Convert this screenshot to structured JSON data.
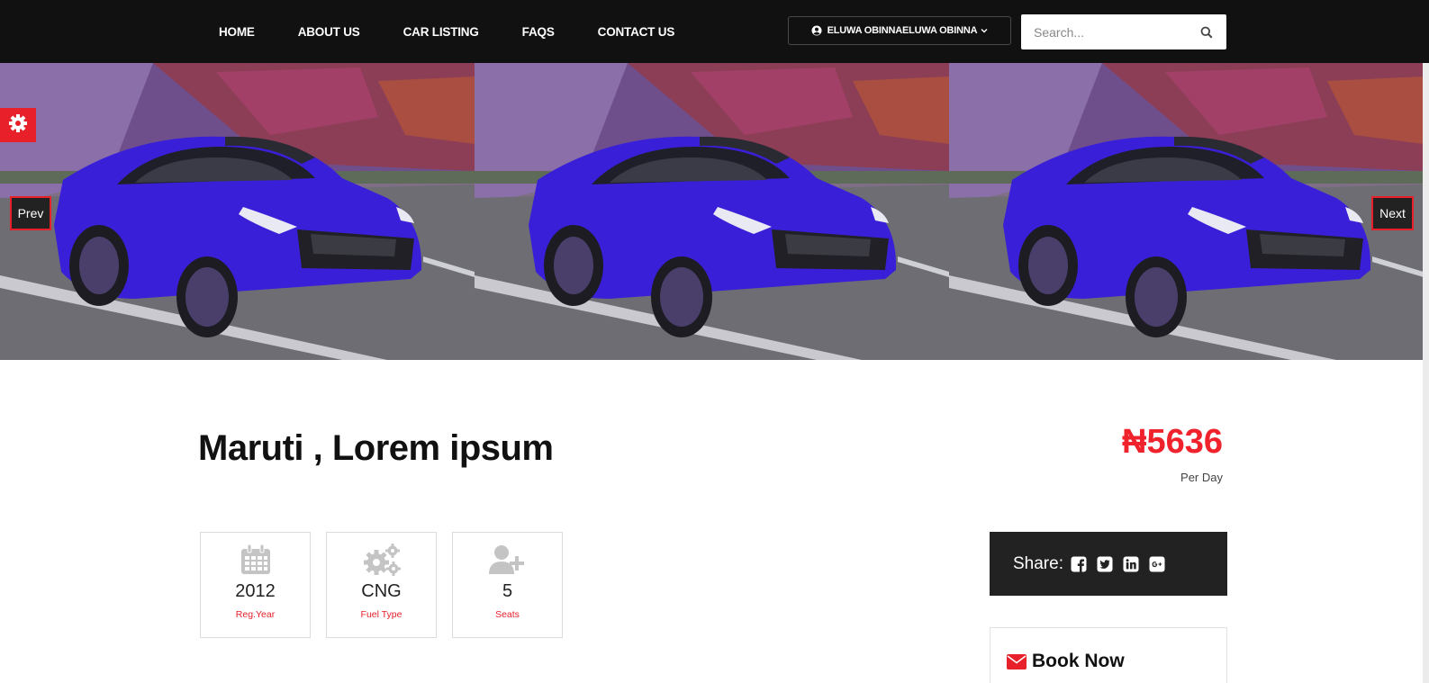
{
  "nav": {
    "items": [
      "HOME",
      "ABOUT US",
      "CAR LISTING",
      "FAQS",
      "CONTACT US"
    ]
  },
  "user_menu": {
    "label": "ELUWA OBINNAELUWA OBINNA"
  },
  "search": {
    "placeholder": "Search..."
  },
  "carousel": {
    "prev_label": "Prev",
    "next_label": "Next",
    "slide_count": 3
  },
  "vehicle": {
    "title": "Maruti , Lorem ipsum",
    "price": "₦5636",
    "price_period": "Per Day"
  },
  "specs": [
    {
      "icon": "calendar-icon",
      "value": "2012",
      "label": "Reg.Year"
    },
    {
      "icon": "gears-icon",
      "value": "CNG",
      "label": "Fuel Type"
    },
    {
      "icon": "user-plus-icon",
      "value": "5",
      "label": "Seats"
    }
  ],
  "share": {
    "label": "Share:",
    "networks": [
      "facebook-icon",
      "twitter-icon",
      "linkedin-icon",
      "google-plus-icon"
    ]
  },
  "booking": {
    "title": "Book Now"
  },
  "colors": {
    "accent": "#e8202a",
    "price": "#f0222c",
    "nav_bg": "#111111",
    "share_bg": "#222222",
    "car_body": "#3a1fd9"
  }
}
